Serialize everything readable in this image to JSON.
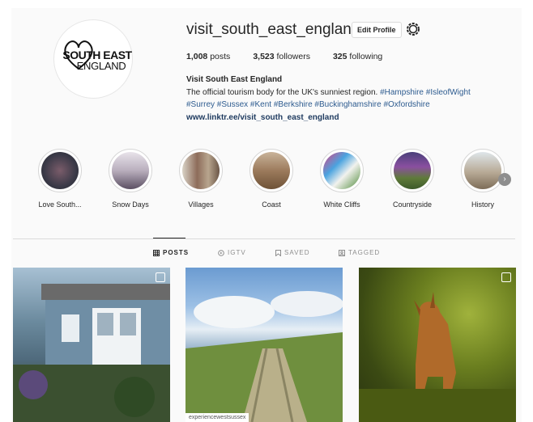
{
  "profile": {
    "username": "visit_south_east_england",
    "edit_button": "Edit Profile",
    "logo_line1": "SOUTH EAST",
    "logo_line2": "ENGLAND",
    "stats": {
      "posts": "1,008",
      "posts_label": "posts",
      "followers": "3,523",
      "followers_label": "followers",
      "following": "325",
      "following_label": "following"
    },
    "display_name": "Visit South East England",
    "bio_text": "The official tourism body for the UK's sunniest region.",
    "hashtags_line1": "#Hampshire #IsleofWight",
    "hashtags_line2": "#Surrey #Sussex #Kent #Berkshire #Buckinghamshire #Oxfordshire",
    "link": "www.linktr.ee/visit_south_east_england"
  },
  "highlights": [
    {
      "label": "Love South..."
    },
    {
      "label": "Snow Days"
    },
    {
      "label": "Villages"
    },
    {
      "label": "Coast"
    },
    {
      "label": "White Cliffs"
    },
    {
      "label": "Countryside"
    },
    {
      "label": "History"
    }
  ],
  "tabs": {
    "posts": "POSTS",
    "igtv": "IGTV",
    "saved": "SAVED",
    "tagged": "TAGGED"
  },
  "posts": {
    "credit": "experiencewestsussex"
  }
}
